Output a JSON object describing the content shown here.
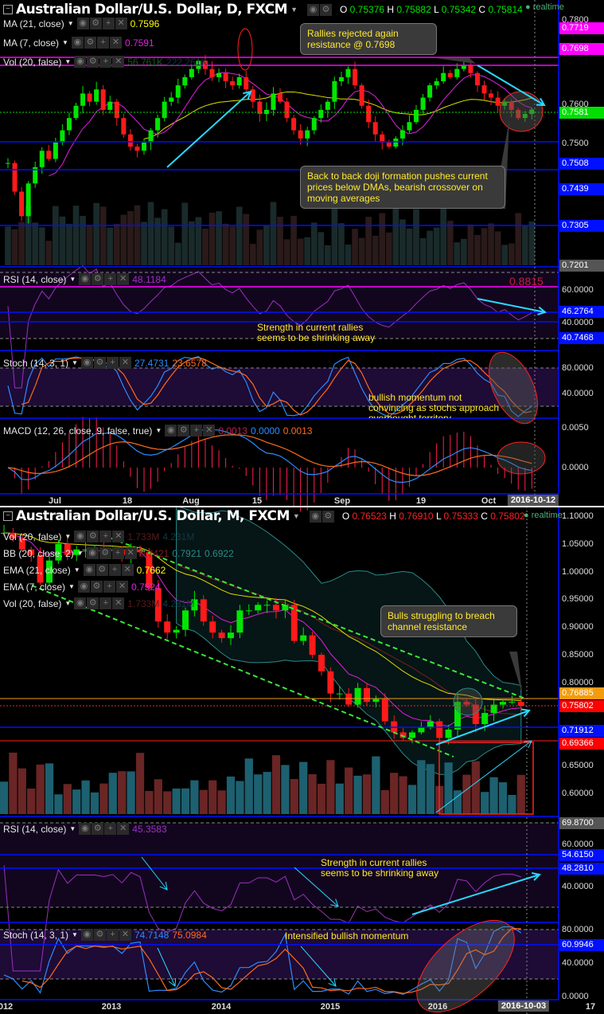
{
  "top": {
    "title": "Australian Dollar/U.S. Dollar, D, FXCM",
    "ohlc": {
      "o": "0.75376",
      "h": "0.75882",
      "l": "0.75342",
      "c": "0.75814"
    },
    "realtime": "realtime",
    "indicators": [
      {
        "name": "MA (21, close)",
        "values": [
          "0.7596"
        ],
        "colors": [
          "#ffff00"
        ]
      },
      {
        "name": "MA (7, close)",
        "values": [
          "0.7591"
        ],
        "colors": [
          "#e020e0"
        ]
      },
      {
        "name": "Vol (20, false)",
        "values": [
          "56.761K",
          "222.261K"
        ],
        "colors": [
          "#0d5a1a",
          "#103040"
        ]
      }
    ],
    "rsi": {
      "name": "RSI (14, close)",
      "value": "48.1184",
      "extra": "0.8815"
    },
    "stoch": {
      "name": "Stoch (14, 3, 1)",
      "k": "27.4731",
      "d": "23.6578"
    },
    "macd": {
      "name": "MACD (12, 26, close, 9, false, true)",
      "values": [
        "0.0013",
        "0.0000",
        "0.0013"
      ]
    },
    "price_axis": [
      "0.7800",
      "0.7600",
      "0.7500"
    ],
    "price_tags": [
      {
        "v": "0.7719",
        "c": "#ff00ff"
      },
      {
        "v": "0.7698",
        "c": "#ff00ff"
      },
      {
        "v": "0.7581",
        "c": "#00e000"
      },
      {
        "v": "0.7508",
        "c": "#0010ff"
      },
      {
        "v": "0.7439",
        "c": "#0010ff"
      },
      {
        "v": "0.7305",
        "c": "#0010ff"
      },
      {
        "v": "0.7201",
        "c": "#555555"
      }
    ],
    "rsi_axis": [
      "60.0000",
      "40.0000"
    ],
    "rsi_tags": [
      "46.2764",
      "40.7468"
    ],
    "stoch_axis": [
      "80.0000",
      "40.0000"
    ],
    "macd_axis": [
      "0.0050",
      "0.0000"
    ],
    "x_labels": [
      "Jul",
      "18",
      "Aug",
      "15",
      "Sep",
      "19",
      "Oct"
    ],
    "x_current": "2016-10-12",
    "notes": {
      "resistance": "Rallies rejected again resistance @ 0.7698",
      "doji": "Back to back doji formation pushes current prices below DMAs, bearish crossover on moving averages",
      "rsi": "Strength in current rallies seems to be shrinking away",
      "stoch": "bullish momentum not convincing as stochs approach overbought territory"
    }
  },
  "bottom": {
    "title": "Australian Dollar/U.S. Dollar, M, FXCM",
    "ohlc": {
      "o": "0.76523",
      "h": "0.76910",
      "l": "0.75333",
      "c": "0.75802"
    },
    "realtime": "realtime",
    "indicators": [
      {
        "name": "Vol (20, false)",
        "values": [
          "1.733M",
          "4.231M"
        ],
        "colors": [
          "#5a1a1a",
          "#103848"
        ]
      },
      {
        "name": "BB (20, close, 2)",
        "values": [
          "0.7421",
          "0.7921",
          "0.6922"
        ],
        "colors": [
          "#7a2020",
          "#2a8a8a",
          "#2a8a8a"
        ]
      },
      {
        "name": "EMA (21, close)",
        "values": [
          "0.7662"
        ],
        "colors": [
          "#ffff00"
        ]
      },
      {
        "name": "EMA (7, close)",
        "values": [
          "0.7524"
        ],
        "colors": [
          "#e020e0"
        ]
      },
      {
        "name": "Vol (20, false)",
        "values": [
          "1.733M",
          "4.231M"
        ],
        "colors": [
          "#5a1a1a",
          "#103848"
        ]
      }
    ],
    "rsi": {
      "name": "RSI (14, close)",
      "value": "45.3583"
    },
    "stoch": {
      "name": "Stoch (14, 3, 1)",
      "k": "74.7148",
      "d": "75.0984"
    },
    "price_axis": [
      "1.10000",
      "1.05000",
      "1.00000",
      "0.95000",
      "0.90000",
      "0.85000",
      "0.80000",
      "0.65000",
      "0.60000"
    ],
    "price_tags": [
      {
        "v": "0.76885",
        "c": "#f39c12"
      },
      {
        "v": "0.75802",
        "c": "#ff0000"
      },
      {
        "v": "0.71912",
        "c": "#0010ff"
      },
      {
        "v": "0.69366",
        "c": "#ff0000"
      }
    ],
    "rsi_axis": [
      "60.0000",
      "40.0000"
    ],
    "rsi_tags": [
      {
        "v": "69.8700",
        "c": "#555555"
      },
      {
        "v": "54.6150",
        "c": "#0010ff"
      },
      {
        "v": "48.2810",
        "c": "#0010ff"
      }
    ],
    "stoch_axis": [
      "80.0000",
      "40.0000",
      "0.0000"
    ],
    "stoch_tags": [
      "60.9946"
    ],
    "x_labels": [
      "012",
      "2013",
      "2014",
      "2015",
      "2016",
      "17"
    ],
    "x_current": "2016-10-03",
    "notes": {
      "channel": "Bulls struggling to breach channel resistance",
      "rsi": "Strength in current rallies seems to be shrinking away",
      "stoch": "Intensified bullish momentum"
    }
  },
  "colors": {
    "up": "#00e600",
    "down": "#ff1a1a",
    "axis": "#0010ff",
    "rsi": "#9b30c0",
    "k": "#2b8cff",
    "d": "#ff6a1a",
    "annot": "#2ad8ff"
  },
  "chart_data": [
    {
      "type": "candlestick",
      "title": "Australian Dollar/U.S. Dollar, D, FXCM",
      "x_range": [
        "2016-06-24",
        "2016-10-12"
      ],
      "ylim": [
        0.7201,
        0.78
      ],
      "close": [
        0.745,
        0.738,
        0.732,
        0.74,
        0.744,
        0.748,
        0.746,
        0.75,
        0.753,
        0.756,
        0.759,
        0.762,
        0.76,
        0.763,
        0.758,
        0.76,
        0.756,
        0.752,
        0.749,
        0.748,
        0.75,
        0.753,
        0.756,
        0.76,
        0.761,
        0.764,
        0.766,
        0.768,
        0.77,
        0.768,
        0.766,
        0.767,
        0.765,
        0.764,
        0.766,
        0.763,
        0.76,
        0.757,
        0.758,
        0.762,
        0.76,
        0.756,
        0.753,
        0.751,
        0.753,
        0.756,
        0.758,
        0.76,
        0.765,
        0.766,
        0.768,
        0.764,
        0.759,
        0.755,
        0.752,
        0.75,
        0.749,
        0.751,
        0.753,
        0.755,
        0.758,
        0.761,
        0.764,
        0.765,
        0.767,
        0.766,
        0.768,
        0.769,
        0.767,
        0.764,
        0.762,
        0.761,
        0.759,
        0.76,
        0.758,
        0.756,
        0.757,
        0.7581
      ]
    },
    {
      "type": "candlestick",
      "title": "Australian Dollar/U.S. Dollar, M, FXCM",
      "x_range": [
        "2012-01",
        "2016-10"
      ],
      "ylim": [
        0.58,
        1.1
      ],
      "close": [
        1.07,
        1.06,
        1.04,
        1.03,
        0.98,
        1.02,
        1.05,
        1.03,
        1.04,
        1.04,
        1.04,
        1.038,
        1.04,
        1.03,
        1.04,
        1.035,
        0.97,
        0.91,
        0.89,
        0.895,
        0.93,
        0.95,
        0.91,
        0.89,
        0.88,
        0.89,
        0.93,
        0.93,
        0.94,
        0.94,
        0.93,
        0.94,
        0.875,
        0.885,
        0.85,
        0.82,
        0.78,
        0.78,
        0.76,
        0.79,
        0.765,
        0.77,
        0.73,
        0.71,
        0.7,
        0.71,
        0.72,
        0.73,
        0.7,
        0.715,
        0.765,
        0.76,
        0.725,
        0.745,
        0.76,
        0.765,
        0.765,
        0.758
      ]
    }
  ]
}
